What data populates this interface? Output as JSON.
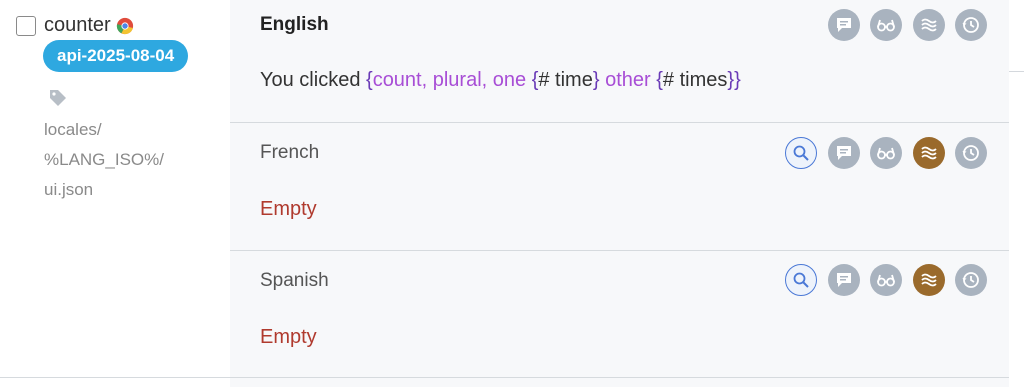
{
  "key": {
    "name": "counter",
    "branch": "api-2025-08-04",
    "path_lines": [
      "locales/",
      "%LANG_ISO%/",
      "ui.json"
    ]
  },
  "source": {
    "language": "English",
    "text_prefix": "You clicked ",
    "text": "{count, plural, one {# time} other {# times}}"
  },
  "translations": [
    {
      "language": "French",
      "value": "Empty"
    },
    {
      "language": "Spanish",
      "value": "Empty"
    }
  ],
  "icons": {
    "comment": "comment-icon",
    "review": "glasses-icon",
    "machine": "waves-icon",
    "history": "history-icon",
    "search": "search-icon",
    "tag": "tag-icon",
    "browser": "chrome-icon"
  },
  "colors": {
    "badge": "#2ea8e0",
    "placeholder": "#a84ed6",
    "brace": "#6a3bb7",
    "empty": "#b03a2e",
    "icon_gray": "#a9b3bf",
    "icon_active": "#9a6a2c",
    "search_ring": "#4a78d6"
  }
}
